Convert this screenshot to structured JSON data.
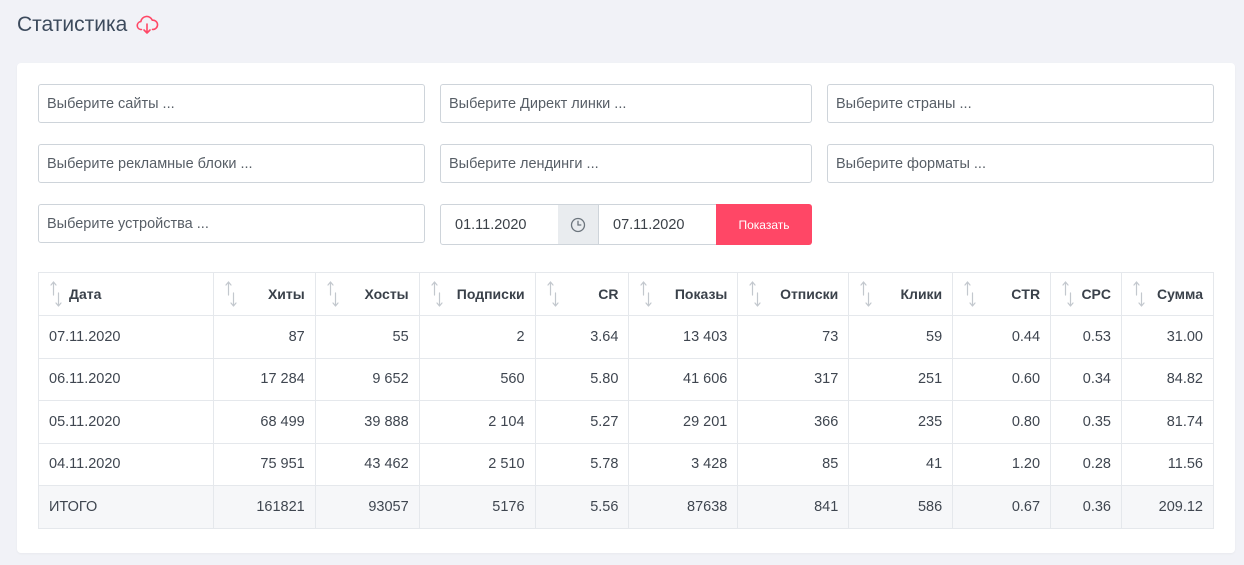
{
  "page": {
    "title": "Статистика",
    "cloud_icon": "cloud-download-icon",
    "accent_color": "#ff4766"
  },
  "filters": {
    "sites": "Выберите сайты ...",
    "direct_links": "Выберите Директ линки ...",
    "countries": "Выберите страны ...",
    "ad_blocks": "Выберите рекламные блоки ...",
    "landings": "Выберите лендинги ...",
    "formats": "Выберите форматы ...",
    "devices": "Выберите устройства ...",
    "date_from": "01.11.2020",
    "date_to": "07.11.2020",
    "show_button": "Показать"
  },
  "table": {
    "columns": [
      "Дата",
      "Хиты",
      "Хосты",
      "Подписки",
      "CR",
      "Показы",
      "Отписки",
      "Клики",
      "CTR",
      "CPC",
      "Сумма"
    ],
    "rows": [
      [
        "07.11.2020",
        "87",
        "55",
        "2",
        "3.64",
        "13 403",
        "73",
        "59",
        "0.44",
        "0.53",
        "31.00"
      ],
      [
        "06.11.2020",
        "17 284",
        "9 652",
        "560",
        "5.80",
        "41 606",
        "317",
        "251",
        "0.60",
        "0.34",
        "84.82"
      ],
      [
        "05.11.2020",
        "68 499",
        "39 888",
        "2 104",
        "5.27",
        "29 201",
        "366",
        "235",
        "0.80",
        "0.35",
        "81.74"
      ],
      [
        "04.11.2020",
        "75 951",
        "43 462",
        "2 510",
        "5.78",
        "3 428",
        "85",
        "41",
        "1.20",
        "0.28",
        "11.56"
      ]
    ],
    "total": [
      "ИТОГО",
      "161821",
      "93057",
      "5176",
      "5.56",
      "87638",
      "841",
      "586",
      "0.67",
      "0.36",
      "209.12"
    ]
  }
}
